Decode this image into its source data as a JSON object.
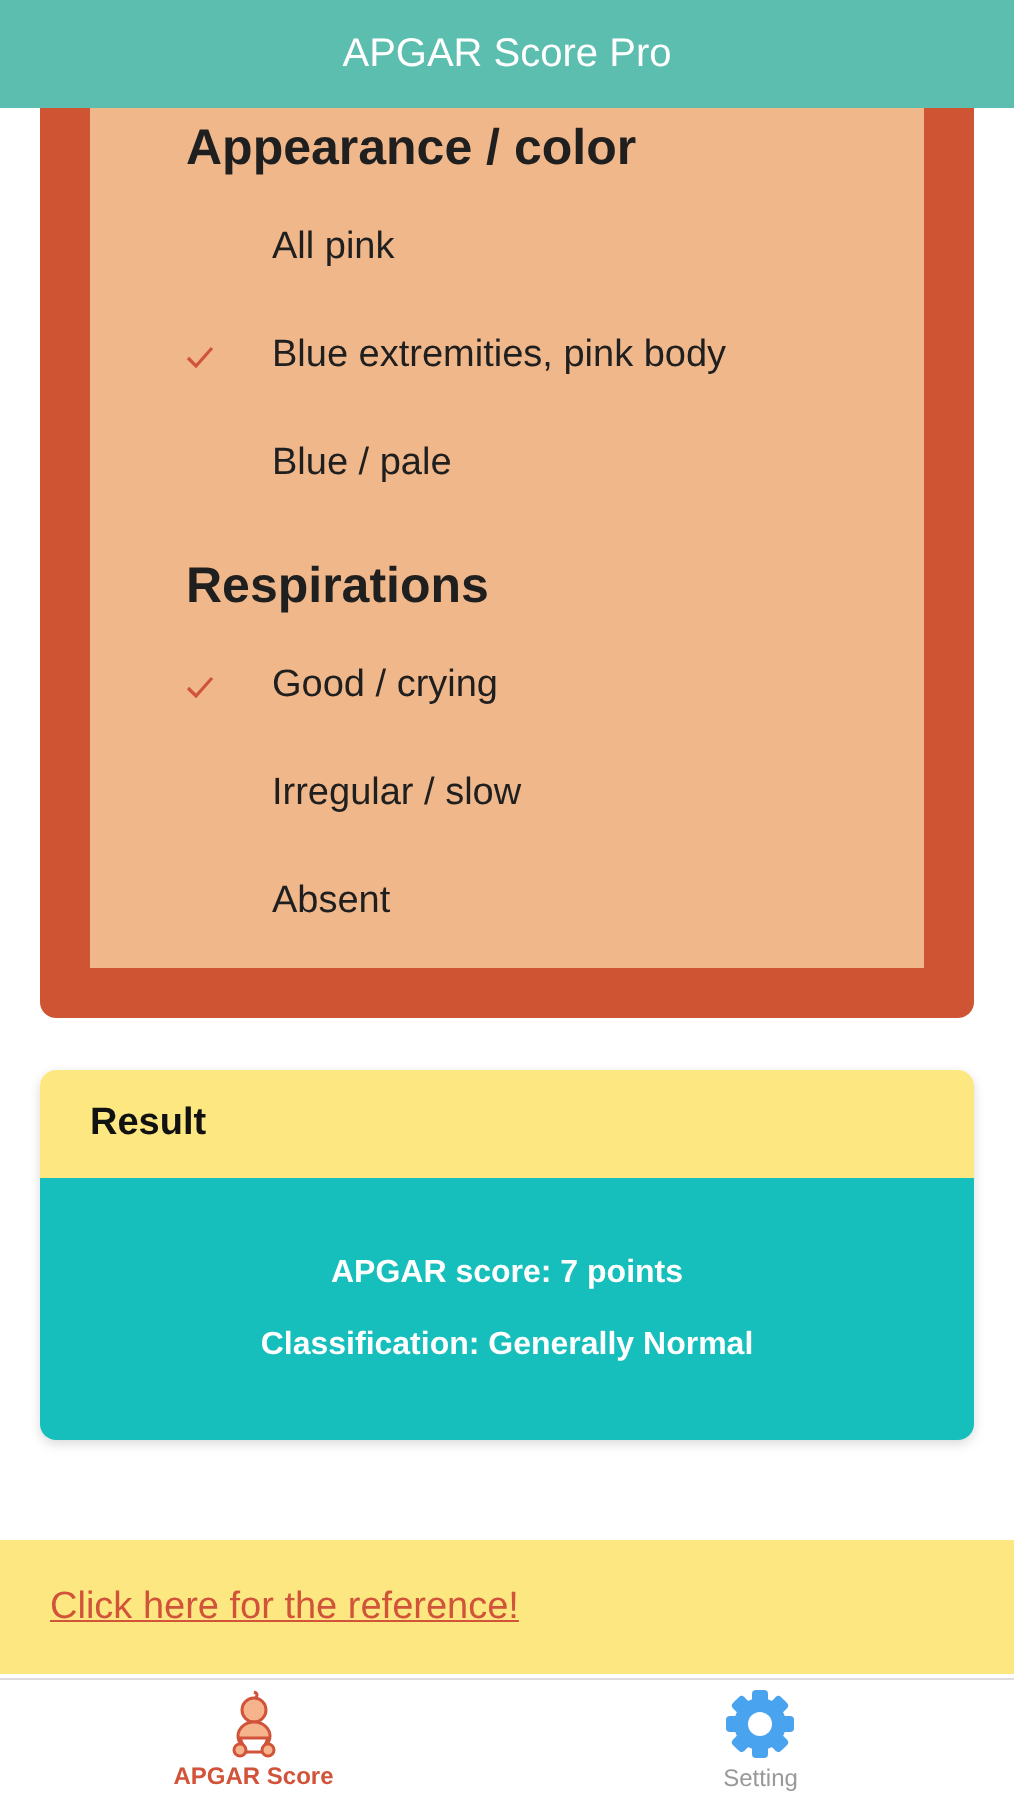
{
  "header": {
    "title": "APGAR Score Pro"
  },
  "criteria": [
    {
      "title": "Appearance / color",
      "options": [
        {
          "label": "All pink",
          "selected": false
        },
        {
          "label": "Blue extremities, pink body",
          "selected": true
        },
        {
          "label": "Blue / pale",
          "selected": false
        }
      ]
    },
    {
      "title": "Respirations",
      "options": [
        {
          "label": "Good / crying",
          "selected": true
        },
        {
          "label": "Irregular / slow",
          "selected": false
        },
        {
          "label": "Absent",
          "selected": false
        }
      ]
    }
  ],
  "result": {
    "title": "Result",
    "score": "APGAR score: 7 points",
    "classification": "Classification: Generally Normal"
  },
  "reference_link": "Click here for the reference!",
  "tabs": [
    {
      "label": "APGAR Score",
      "kind": "baby",
      "selected": true
    },
    {
      "label": "Setting",
      "kind": "gear",
      "selected": false
    }
  ]
}
